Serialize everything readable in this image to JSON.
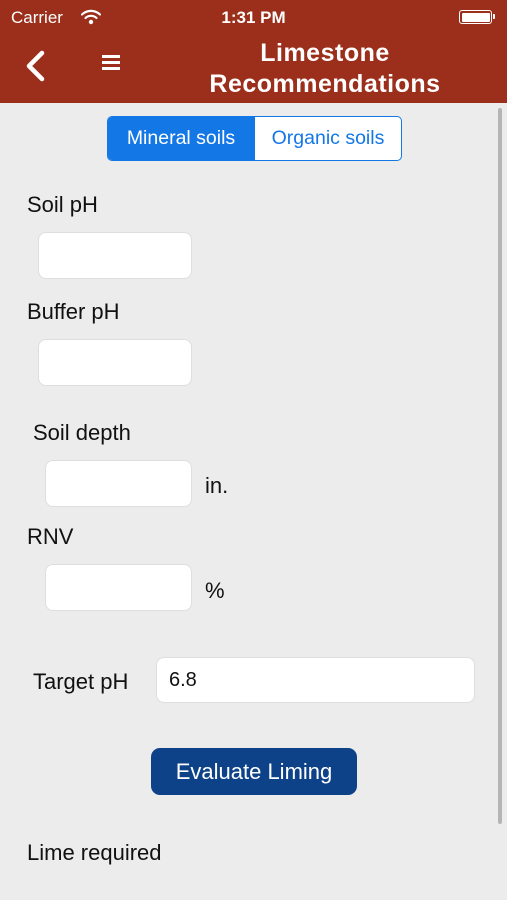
{
  "status_bar": {
    "carrier": "Carrier",
    "time": "1:31 PM"
  },
  "nav": {
    "title_line1": "Limestone",
    "title_line2": "Recommendations"
  },
  "soil_type": {
    "options": [
      "Mineral soils",
      "Organic soils"
    ],
    "selected": "Mineral soils"
  },
  "form": {
    "soil_ph": {
      "label": "Soil pH",
      "value": ""
    },
    "buffer_ph": {
      "label": "Buffer pH",
      "value": ""
    },
    "soil_depth": {
      "label": "Soil depth",
      "value": "",
      "unit": "in."
    },
    "rnv": {
      "label": "RNV",
      "value": "",
      "unit": "%"
    },
    "target_ph": {
      "label": "Target pH",
      "value": "6.8"
    }
  },
  "evaluate_label": "Evaluate Liming",
  "result": {
    "label": "Lime required"
  },
  "colors": {
    "nav_bar": "#9b2f1b",
    "accent": "#1477e6",
    "button": "#0d4288"
  }
}
